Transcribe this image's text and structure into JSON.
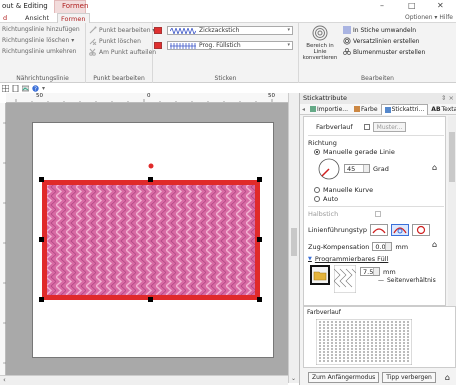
{
  "window": {
    "title": "out & Editing",
    "controls": [
      "–",
      "□",
      "✕"
    ]
  },
  "tabs": [
    {
      "label": "Formen",
      "active": false
    },
    {
      "label": "Ansicht",
      "active": false
    },
    {
      "label": "Formen",
      "active": true
    }
  ],
  "ribbon": {
    "right_links": "Optionen ▾ Hilfe",
    "groups": {
      "naehrichtung": {
        "label": "Nährichtungslinie",
        "items": [
          "Richtungslinie hinzufügen",
          "Richtungslinie löschen ▾",
          "Richtungslinie umkehren"
        ]
      },
      "punkt": {
        "label": "Punkt bearbeiten",
        "items": [
          "Punkt bearbeiten ▾",
          "Punkt löschen",
          "Am Punkt aufteilen"
        ]
      },
      "sticken": {
        "label": "Sticken",
        "line_stitch": "Zickzackstich",
        "fill_stitch": "Prog. Füllstich"
      },
      "bearbeiten": {
        "label": "Bearbeiten",
        "big_button": "Bereich in Linie konvertieren",
        "items": [
          "In Stiche umwandeln",
          "Versatzlinien erstellen",
          "Blumenmuster erstellen"
        ]
      }
    }
  },
  "ruler": {
    "ticks": [
      "50",
      "0",
      "50"
    ]
  },
  "panel": {
    "title": "Stickattribute",
    "pin": "⇕ ×",
    "tabs": [
      "Importie...",
      "Farbe",
      "Stickattri...",
      "Textattri..."
    ],
    "gradient_label": "Farbverlauf",
    "muster_button": "Muster...",
    "direction_title": "Richtung",
    "manual_straight": "Manuelle gerade Linie",
    "angle_value": "45",
    "angle_unit": "Grad",
    "manual_curve": "Manuelle Kurve",
    "auto": "Auto",
    "halbstich": "Halbstich",
    "route_label": "Linienführungstyp",
    "comp_label": "Zug-Kompensation",
    "comp_value": "0.0",
    "comp_unit": "mm",
    "prog_fill_label": "Programmierbares Füll",
    "size_value": "7.5",
    "size_unit": "mm",
    "ratio_label": "Seitenverhältnis",
    "gradient_preview_label": "Farbverlauf",
    "footer_buttons": [
      "Zum Anfängermodus",
      "Tipp verbergen"
    ]
  }
}
